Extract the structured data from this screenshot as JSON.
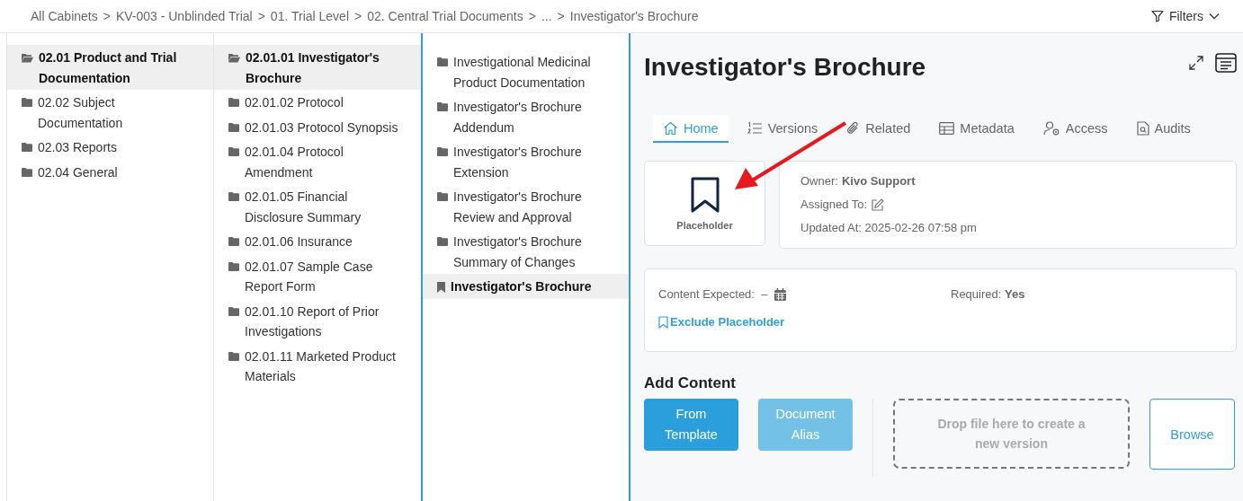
{
  "breadcrumb": {
    "items": [
      "All Cabinets",
      "KV-003 - Unblinded Trial",
      "01. Trial Level",
      "02. Central Trial Documents",
      "...",
      "Investigator's Brochure"
    ],
    "separator": ">"
  },
  "filters": {
    "label": "Filters"
  },
  "columns": [
    {
      "items": [
        {
          "label": "02.01 Product and Trial Documentation",
          "kind": "folder",
          "selected": true
        },
        {
          "label": "02.02 Subject Documentation",
          "kind": "folder",
          "selected": false
        },
        {
          "label": "02.03 Reports",
          "kind": "folder",
          "selected": false
        },
        {
          "label": "02.04 General",
          "kind": "folder",
          "selected": false
        }
      ]
    },
    {
      "items": [
        {
          "label": "02.01.01 Investigator's Brochure",
          "kind": "folder",
          "selected": true
        },
        {
          "label": "02.01.02 Protocol",
          "kind": "folder",
          "selected": false
        },
        {
          "label": "02.01.03 Protocol Synopsis",
          "kind": "folder",
          "selected": false
        },
        {
          "label": "02.01.04 Protocol Amendment",
          "kind": "folder",
          "selected": false
        },
        {
          "label": "02.01.05 Financial Disclosure Summary",
          "kind": "folder",
          "selected": false
        },
        {
          "label": "02.01.06 Insurance",
          "kind": "folder",
          "selected": false
        },
        {
          "label": "02.01.07 Sample Case Report Form",
          "kind": "folder",
          "selected": false
        },
        {
          "label": "02.01.10 Report of Prior Investigations",
          "kind": "folder",
          "selected": false
        },
        {
          "label": "02.01.11 Marketed Product Materials",
          "kind": "folder",
          "selected": false
        }
      ]
    },
    {
      "items": [
        {
          "label": "Investigational Medicinal Product Documentation",
          "kind": "folder",
          "selected": false
        },
        {
          "label": "Investigator's Brochure Addendum",
          "kind": "folder",
          "selected": false
        },
        {
          "label": "Investigator's Brochure Extension",
          "kind": "folder",
          "selected": false
        },
        {
          "label": "Investigator's Brochure Review and Approval",
          "kind": "folder",
          "selected": false
        },
        {
          "label": "Investigator's Brochure Summary of Changes",
          "kind": "folder",
          "selected": false
        },
        {
          "label": "Investigator's Brochure",
          "kind": "placeholder",
          "selected": true
        }
      ]
    }
  ],
  "document": {
    "title": "Investigator's Brochure",
    "tabs": [
      {
        "label": "Home",
        "selected": true
      },
      {
        "label": "Versions",
        "selected": false
      },
      {
        "label": "Related",
        "selected": false
      },
      {
        "label": "Metadata",
        "selected": false
      },
      {
        "label": "Access",
        "selected": false
      },
      {
        "label": "Audits",
        "selected": false
      }
    ],
    "type_label": "Placeholder",
    "owner": "Owner: **Kivo Support**",
    "assigned_to": "Assigned To:",
    "updated_at": "Updated At: 2025-02-26 07:58 pm",
    "content_expected": "Content Expected:  –",
    "required": "Required: **Yes**",
    "exclude_link": "Exclude Placeholder",
    "add_content": {
      "heading": "Add Content",
      "buttons": [
        {
          "label": "From Template",
          "disabled": false
        },
        {
          "label": "Document Alias",
          "disabled": true
        }
      ],
      "drop_zone": "Drop file here to create a new version",
      "browse": "Browse"
    }
  }
}
